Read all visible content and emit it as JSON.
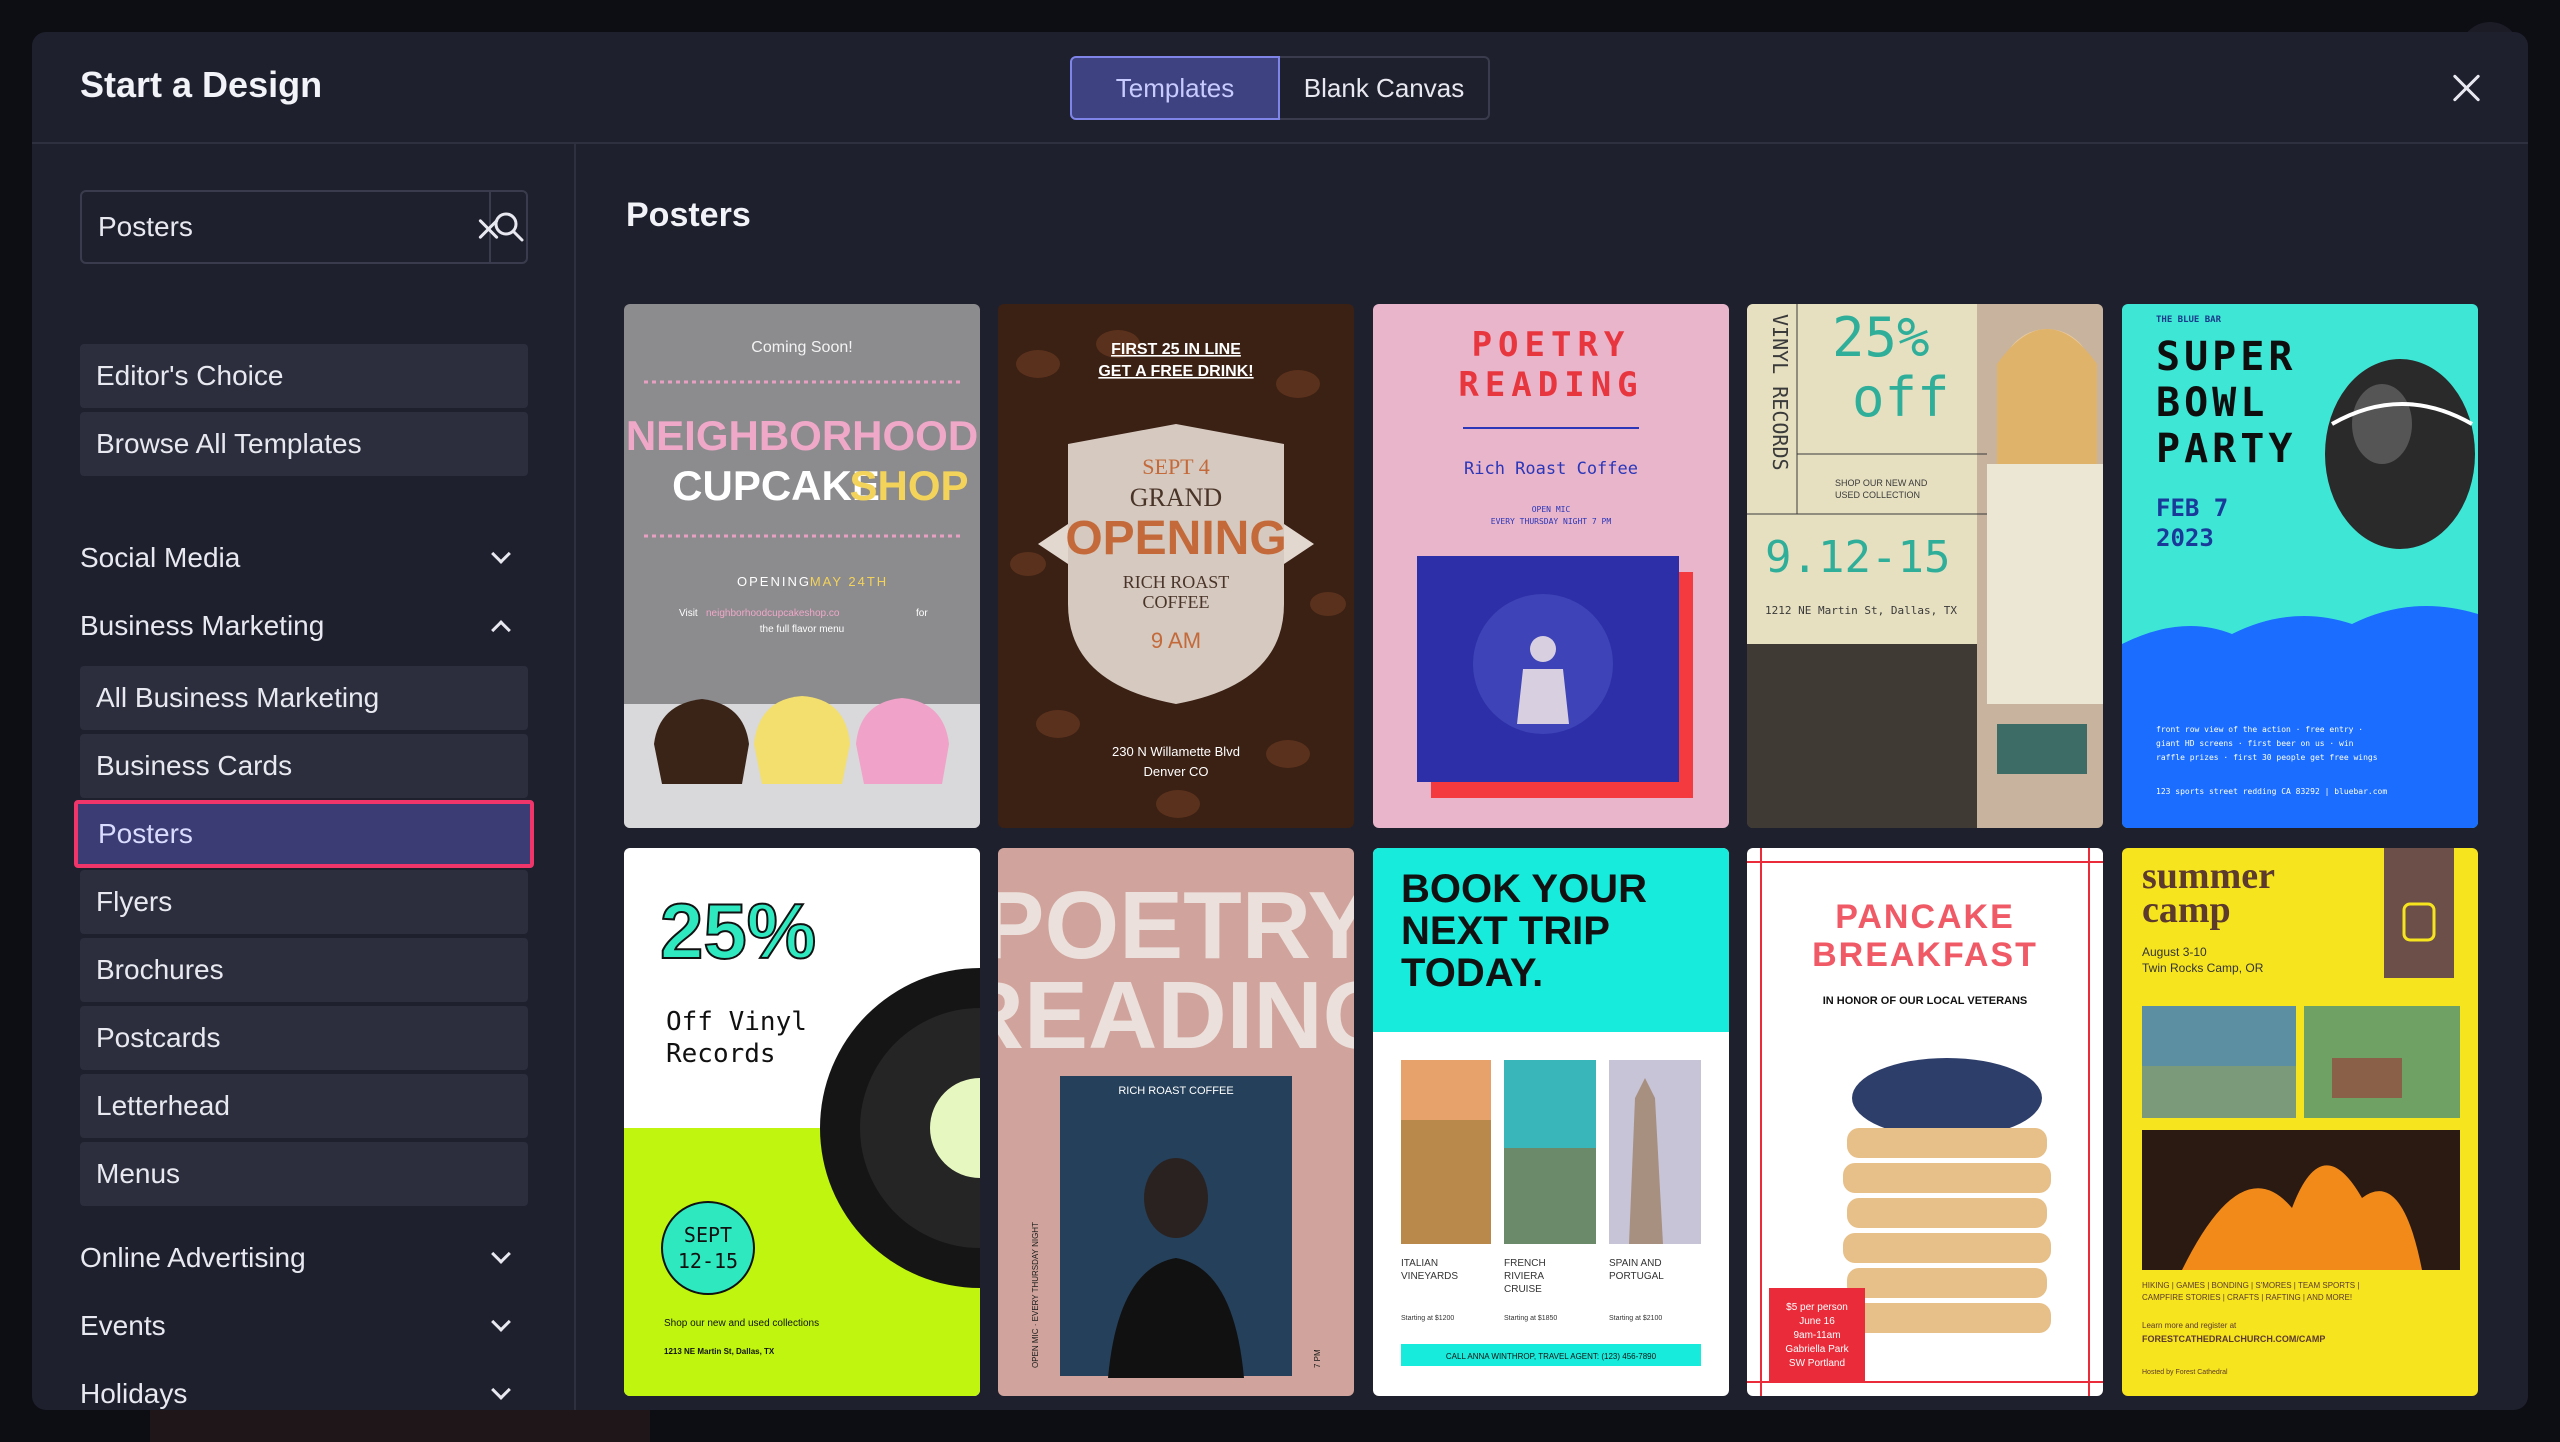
{
  "modal": {
    "title": "Start a Design",
    "tabs": [
      {
        "label": "Templates",
        "active": true
      },
      {
        "label": "Blank Canvas",
        "active": false
      }
    ]
  },
  "search": {
    "value": "Posters"
  },
  "sidebar": {
    "top_items": [
      "Editor's Choice",
      "Browse All Templates"
    ],
    "categories": [
      {
        "label": "Social Media",
        "expanded": false
      },
      {
        "label": "Business Marketing",
        "expanded": true
      }
    ],
    "business_marketing_items": [
      "All Business Marketing",
      "Business Cards",
      "Posters",
      "Flyers",
      "Brochures",
      "Postcards",
      "Letterhead",
      "Menus"
    ],
    "selected_item": "Posters",
    "more_categories": [
      "Online Advertising",
      "Events",
      "Holidays"
    ]
  },
  "content": {
    "title": "Posters",
    "templates": [
      {
        "name": "neighborhood-cupcake-shop",
        "text": {
          "coming": "Coming Soon!",
          "line1": "NEIGHBORHOOD",
          "line2a": "CUPCAKE",
          "line2b": "SHOP",
          "opening": "OPENING",
          "date": "MAY 24TH",
          "visit": "Visit",
          "url": "neighborhoodcupcakeshop.co",
          "for": "for",
          "menu": "the full flavor menu"
        }
      },
      {
        "name": "grand-opening-coffee",
        "text": {
          "top1": "FIRST 25 IN LINE",
          "top2": "GET A FREE DRINK!",
          "sept": "SEPT 4",
          "grand": "GRAND",
          "opening": "OPENING",
          "rich": "RICH ROAST",
          "coffee": "COFFEE",
          "time": "9 AM",
          "addr1": "230 N Willamette Blvd",
          "addr2": "Denver CO"
        }
      },
      {
        "name": "poetry-reading-pink",
        "text": {
          "l1": "POETRY",
          "l2": "READING",
          "sub": "Rich Roast Coffee",
          "small1": "OPEN MIC",
          "small2": "EVERY THURSDAY NIGHT 7 PM"
        }
      },
      {
        "name": "vinyl-records-sale",
        "text": {
          "side": "VINYL RECORDS",
          "pct": "25%",
          "off": "off",
          "shop1": "SHOP OUR NEW AND",
          "shop2": "USED COLLECTION",
          "dates": "9.12-15",
          "addr": "1212 NE Martin St, Dallas, TX"
        }
      },
      {
        "name": "super-bowl-party",
        "text": {
          "bar": "THE BLUE BAR",
          "l1": "SUPER",
          "l2": "BOWL",
          "l3": "PARTY",
          "d1": "FEB 7",
          "d2": "2023",
          "f1": "front row view of the action · free entry ·",
          "f2": "giant HD screens · first beer on us · win",
          "f3": "raffle prizes · first 30 people get free wings",
          "addr": "123 sports street redding CA 83292 | bluebar.com"
        }
      },
      {
        "name": "off-vinyl-records",
        "text": {
          "pct": "25%",
          "l1": "Off Vinyl",
          "l2": "Records",
          "sept": "SEPT",
          "dates": "12-15",
          "shop": "Shop our new and used collections",
          "addr": "1213 NE Martin St, Dallas, TX"
        }
      },
      {
        "name": "poetry-reading-photo",
        "text": {
          "l1": "POETRY",
          "l2": "READING",
          "sub": "RICH ROAST COFFEE",
          "side": "OPEN MIC · EVERY THURSDAY NIGHT",
          "time": "7 PM"
        }
      },
      {
        "name": "book-your-next-trip",
        "text": {
          "l1": "BOOK YOUR",
          "l2": "NEXT TRIP",
          "l3": "TODAY.",
          "p1a": "ITALIAN",
          "p1b": "VINEYARDS",
          "p2a": "FRENCH",
          "p2b": "RIVIERA",
          "p2c": "CRUISE",
          "p3a": "SPAIN AND",
          "p3b": "PORTUGAL",
          "s1": "Starting at $1200",
          "s2": "Starting at $1850",
          "s3": "Starting at $2100",
          "call": "CALL ANNA WINTHROP, TRAVEL AGENT: (123) 456-7890"
        }
      },
      {
        "name": "pancake-breakfast",
        "text": {
          "l1": "PANCAKE",
          "l2": "BREAKFAST",
          "sub": "IN HONOR OF OUR LOCAL VETERANS",
          "b1": "$5 per person",
          "b2": "June 16",
          "b3": "9am-11am",
          "b4": "Gabriella Park",
          "b5": "SW Portland"
        }
      },
      {
        "name": "summer-camp",
        "text": {
          "l1": "summer",
          "l2": "camp",
          "date": "August 3-10",
          "place": "Twin Rocks Camp, OR",
          "acts1": "HIKING | GAMES | BONDING | S'MORES | TEAM SPORTS |",
          "acts2": "CAMPFIRE STORIES | CRAFTS | RAFTING | AND MORE!",
          "learn": "Learn more and register at",
          "url": "FORESTCATHEDRALCHURCH.COM/CAMP",
          "host": "Hosted by Forest Cathedral"
        }
      }
    ]
  },
  "colors": {
    "accent": "#7e84e8",
    "selected_border": "#f0356b",
    "modal_bg": "#1f202d"
  }
}
